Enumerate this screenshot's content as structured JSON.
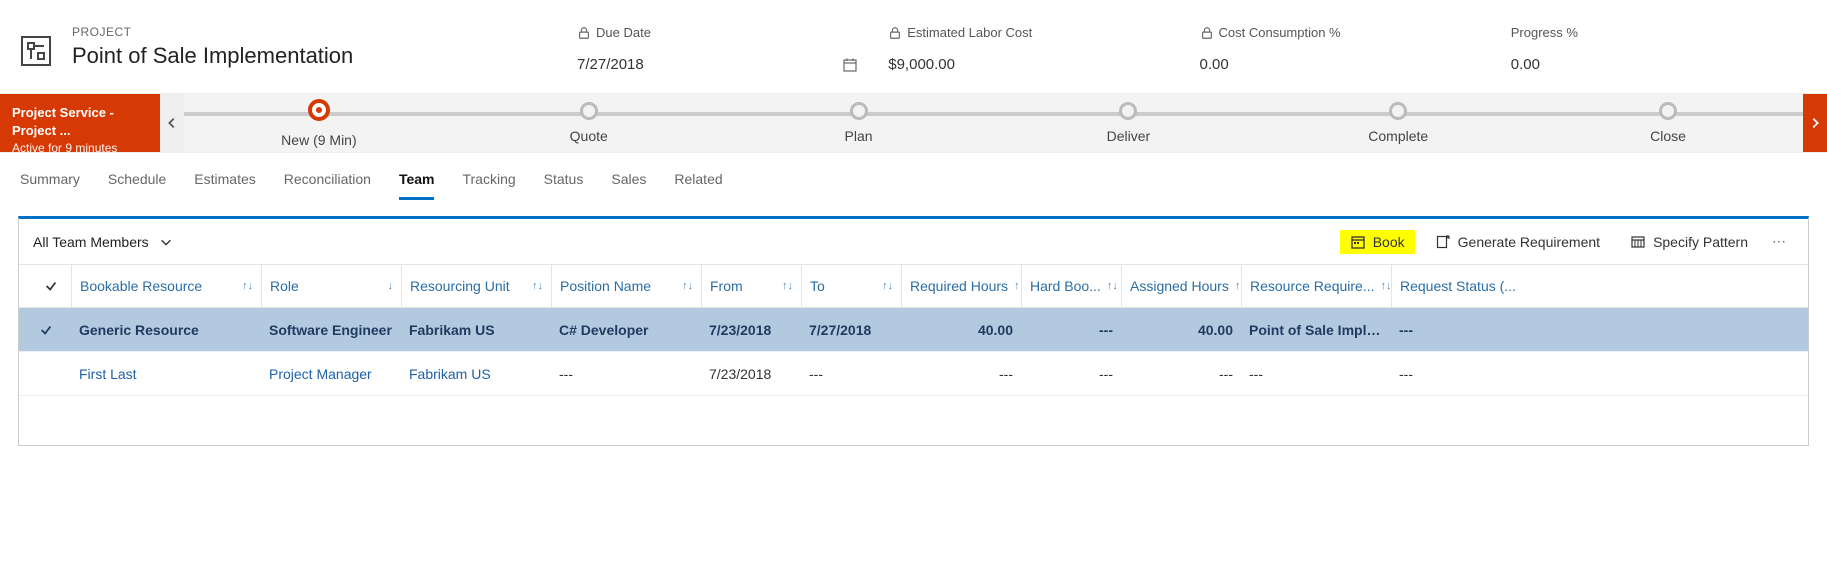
{
  "header": {
    "entity_label": "PROJECT",
    "title": "Point of Sale Implementation",
    "fields": {
      "due_date": {
        "label": "Due Date",
        "value": "7/27/2018"
      },
      "est_labor_cost": {
        "label": "Estimated Labor Cost",
        "value": "$9,000.00"
      },
      "cost_consumption": {
        "label": "Cost Consumption %",
        "value": "0.00"
      },
      "progress": {
        "label": "Progress %",
        "value": "0.00"
      }
    }
  },
  "process": {
    "flow_name": "Project Service - Project ...",
    "active_text": "Active for 9 minutes",
    "stages": [
      {
        "label": "New  (9 Min)",
        "active": true
      },
      {
        "label": "Quote"
      },
      {
        "label": "Plan"
      },
      {
        "label": "Deliver"
      },
      {
        "label": "Complete"
      },
      {
        "label": "Close"
      }
    ]
  },
  "tabs": {
    "items": [
      {
        "label": "Summary"
      },
      {
        "label": "Schedule"
      },
      {
        "label": "Estimates"
      },
      {
        "label": "Reconciliation"
      },
      {
        "label": "Team",
        "active": true
      },
      {
        "label": "Tracking"
      },
      {
        "label": "Status"
      },
      {
        "label": "Sales"
      },
      {
        "label": "Related"
      }
    ]
  },
  "grid": {
    "view_name": "All Team Members",
    "toolbar": {
      "book": "Book",
      "generate_req": "Generate Requirement",
      "specify_pattern": "Specify Pattern"
    },
    "columns": {
      "bookable_resource": "Bookable Resource",
      "role": "Role",
      "resourcing_unit": "Resourcing Unit",
      "position_name": "Position Name",
      "from": "From",
      "to": "To",
      "required_hours": "Required Hours",
      "hard_book": "Hard Boo...",
      "assigned_hours": "Assigned Hours",
      "resource_req": "Resource Require...",
      "request_status": "Request Status (..."
    },
    "rows": [
      {
        "selected": true,
        "bookable_resource": "Generic Resource",
        "role": "Software Engineer",
        "resourcing_unit": "Fabrikam US",
        "position_name": "C# Developer",
        "from": "7/23/2018",
        "to": "7/27/2018",
        "required_hours": "40.00",
        "hard_book": "---",
        "assigned_hours": "40.00",
        "resource_req": "Point of Sale Implem...",
        "request_status": "---"
      },
      {
        "selected": false,
        "bookable_resource": "First Last",
        "role": "Project Manager",
        "resourcing_unit": "Fabrikam US",
        "position_name": "---",
        "from": "7/23/2018",
        "to": "---",
        "required_hours": "---",
        "hard_book": "---",
        "assigned_hours": "---",
        "resource_req": "---",
        "request_status": "---"
      }
    ]
  }
}
